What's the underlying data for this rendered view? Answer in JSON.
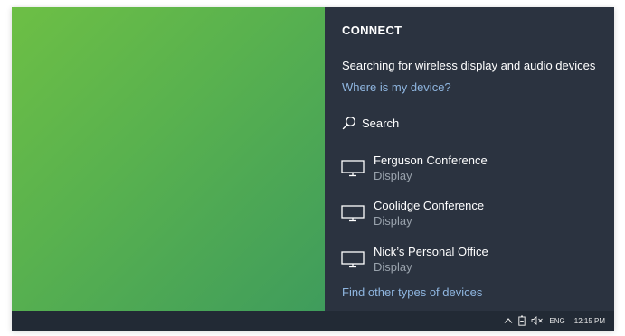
{
  "panel": {
    "title": "CONNECT",
    "status": "Searching for wireless display and audio devices",
    "where_link": "Where is my device?",
    "search_label": "Search",
    "find_other_link": "Find other types of devices"
  },
  "devices": [
    {
      "name": "Ferguson Conference",
      "type": "Display",
      "icon": "monitor-icon"
    },
    {
      "name": "Coolidge Conference",
      "type": "Display",
      "icon": "monitor-icon"
    },
    {
      "name": "Nick’s Personal Office",
      "type": "Display",
      "icon": "monitor-icon"
    }
  ],
  "taskbar": {
    "icons": [
      "chevron-up-icon",
      "battery-icon",
      "volume-muted-icon"
    ],
    "language": "ENG",
    "time": "12:15 PM"
  },
  "colors": {
    "panel_bg": "#2b3340",
    "taskbar_bg": "#222a35",
    "link": "#8fb6e0",
    "desktop_start": "#6dbf45",
    "desktop_end": "#3f9c5c"
  }
}
